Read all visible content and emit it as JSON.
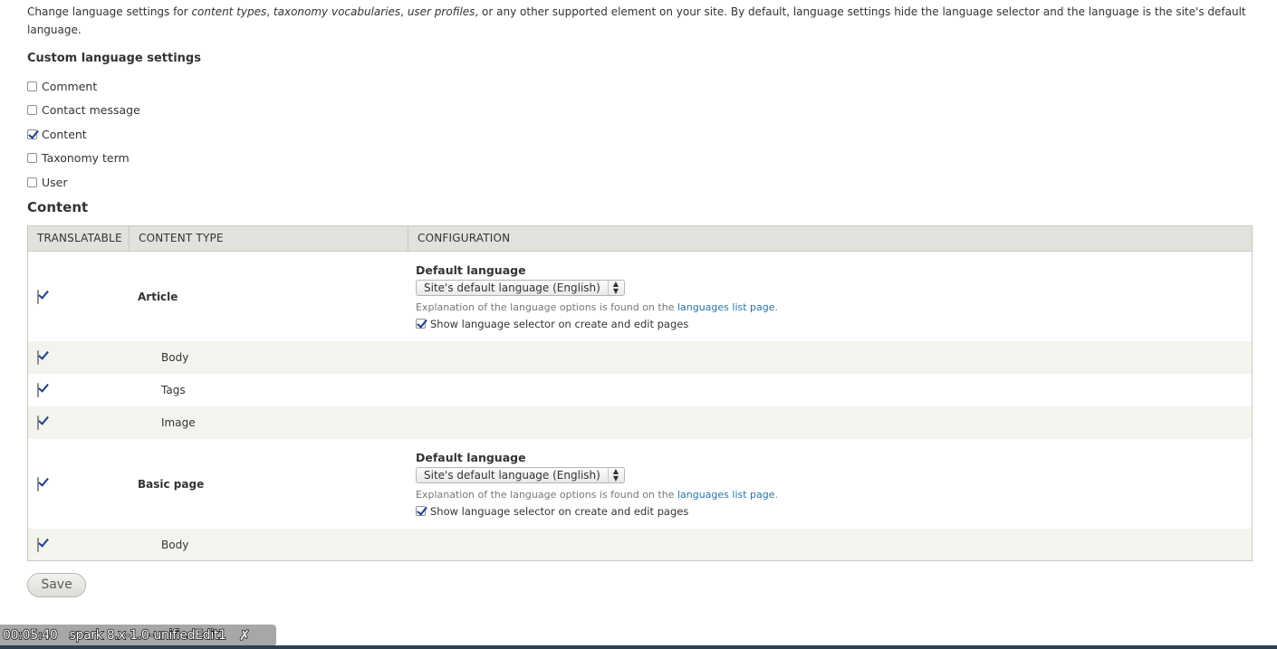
{
  "intro": {
    "text_1": "Change language settings for ",
    "em_1": "content types",
    "sep_1": ", ",
    "em_2": "taxonomy vocabularies",
    "sep_2": ", ",
    "em_3": "user profiles",
    "text_2": ", or any other supported element on your site. By default, language settings hide the language selector and the language is the site's default language."
  },
  "custom_settings": {
    "label": "Custom language settings",
    "items": [
      {
        "label": "Comment",
        "checked": false
      },
      {
        "label": "Contact message",
        "checked": false
      },
      {
        "label": "Content",
        "checked": true
      },
      {
        "label": "Taxonomy term",
        "checked": false
      },
      {
        "label": "User",
        "checked": false
      }
    ]
  },
  "content_section": {
    "heading": "Content",
    "headers": [
      "TRANSLATABLE",
      "CONTENT TYPE",
      "CONFIGURATION"
    ],
    "config": {
      "default_language_label": "Default language",
      "select_value": "Site's default language (English)",
      "help_prefix": "Explanation of the language options is found on the ",
      "help_link": "languages list page",
      "help_suffix": ".",
      "show_selector_label": "Show language selector on create and edit pages"
    },
    "rows": [
      {
        "name": "Article",
        "translatable": true
      },
      {
        "name": "Body",
        "translatable": true
      },
      {
        "name": "Tags",
        "translatable": true
      },
      {
        "name": "Image",
        "translatable": true
      },
      {
        "name": "Basic page",
        "translatable": true
      },
      {
        "name": "Body",
        "translatable": true
      }
    ]
  },
  "save_label": "Save",
  "overlay": {
    "time": "00:05:40",
    "title": "spark 8.x-1.0-unifiedEdit1",
    "close": "✗"
  }
}
